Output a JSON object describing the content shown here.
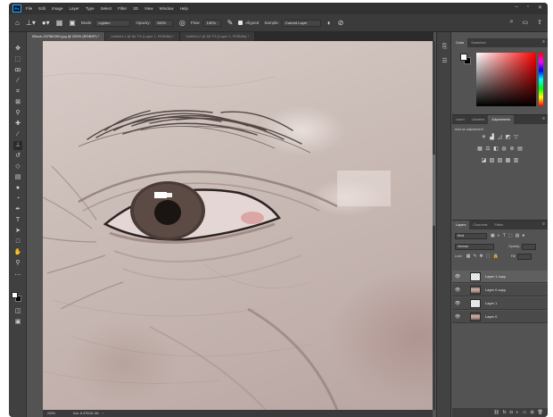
{
  "menu": {
    "items": [
      "File",
      "Edit",
      "Image",
      "Layer",
      "Type",
      "Select",
      "Filter",
      "3D",
      "View",
      "Window",
      "Help"
    ],
    "window_controls": [
      "–",
      "▫",
      "✕"
    ]
  },
  "options_bar": {
    "mode_label": "Mode:",
    "mode_value": "Lighten",
    "opacity_label": "Opacity:",
    "opacity_value": "100%",
    "flow_label": "Flow:",
    "flow_value": "100%",
    "aligned_label": "Aligned",
    "sample_label": "Sample:",
    "sample_value": "Current Layer"
  },
  "tabs": [
    {
      "label": "iStock-157581591.jpg @ 200% (RGB/8*) *"
    },
    {
      "label": "Untitled-1 @ 66.7% (Layer 1, RGB/8#) *"
    },
    {
      "label": "Untitled-2 @ 66.7% (Layer 1, RGB/8#) *"
    }
  ],
  "status": {
    "zoom": "200%",
    "doc": "Doc: 8.37M/31.0M"
  },
  "color_panel": {
    "tabs": [
      "Color",
      "Swatches"
    ]
  },
  "adjustments_panel": {
    "tabs": [
      "Learn",
      "Libraries",
      "Adjustments"
    ],
    "title": "Add an adjustment"
  },
  "layers_panel": {
    "tabs": [
      "Layers",
      "Channels",
      "Paths"
    ],
    "kind_value": "Kind",
    "blend_value": "Normal",
    "opacity_label": "Opacity:",
    "lock_label": "Lock:",
    "fill_label": "Fill:",
    "layers": [
      {
        "name": "Layer 1 copy",
        "thumb": "transparent",
        "selected": true
      },
      {
        "name": "Layer 0 copy",
        "thumb": "face",
        "selected": false
      },
      {
        "name": "Layer 1",
        "thumb": "transparent",
        "selected": false
      },
      {
        "name": "Layer 0",
        "thumb": "face",
        "selected": false
      }
    ]
  }
}
